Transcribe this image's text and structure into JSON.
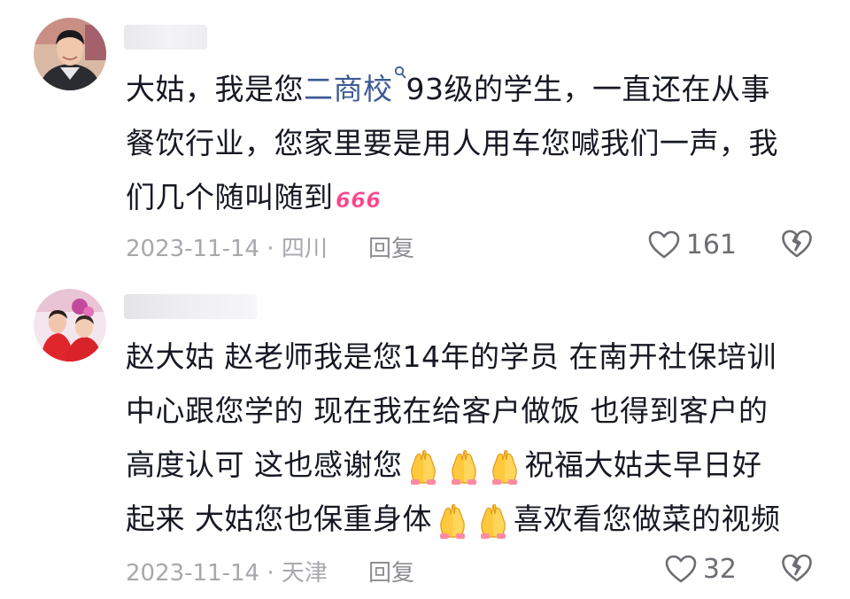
{
  "comments": [
    {
      "text_lines": [
        {
          "a": "大姑，我是您",
          "link": "二商校",
          "b": "93级的学生，一直还在从事"
        },
        {
          "text": "餐饮行业，您家里要是用人用车您喊我们一声，我"
        },
        {
          "text": "们几个随叫随到",
          "emoji": "666"
        }
      ],
      "date": "2023-11-14",
      "location": "四川",
      "reply_label": "回复",
      "likes": "161"
    },
    {
      "text_lines": [
        {
          "text": "赵大姑  赵老师我是您14年的学员  在南开社保培训"
        },
        {
          "text": "中心跟您学的  现在我在给客户做饭  也得到客户的"
        },
        {
          "text": "高度认可  这也感谢您",
          "after": "祝福大姑夫早日好"
        },
        {
          "text": "起来  大姑您也保重身体",
          "after": "喜欢看您做菜的视频"
        }
      ],
      "date": "2023-11-14",
      "location": "天津",
      "reply_label": "回复",
      "likes": "32"
    }
  ],
  "separator": "·",
  "icons": {
    "like": "heart-outline-icon",
    "dislike": "broken-heart-icon",
    "search": "search-icon",
    "emoji": "praying-hands-emoji"
  },
  "colors": {
    "text": "#161823",
    "meta": "#a7a8ad",
    "link": "#3c5a94",
    "emoji_666": "#ff3d8b"
  }
}
